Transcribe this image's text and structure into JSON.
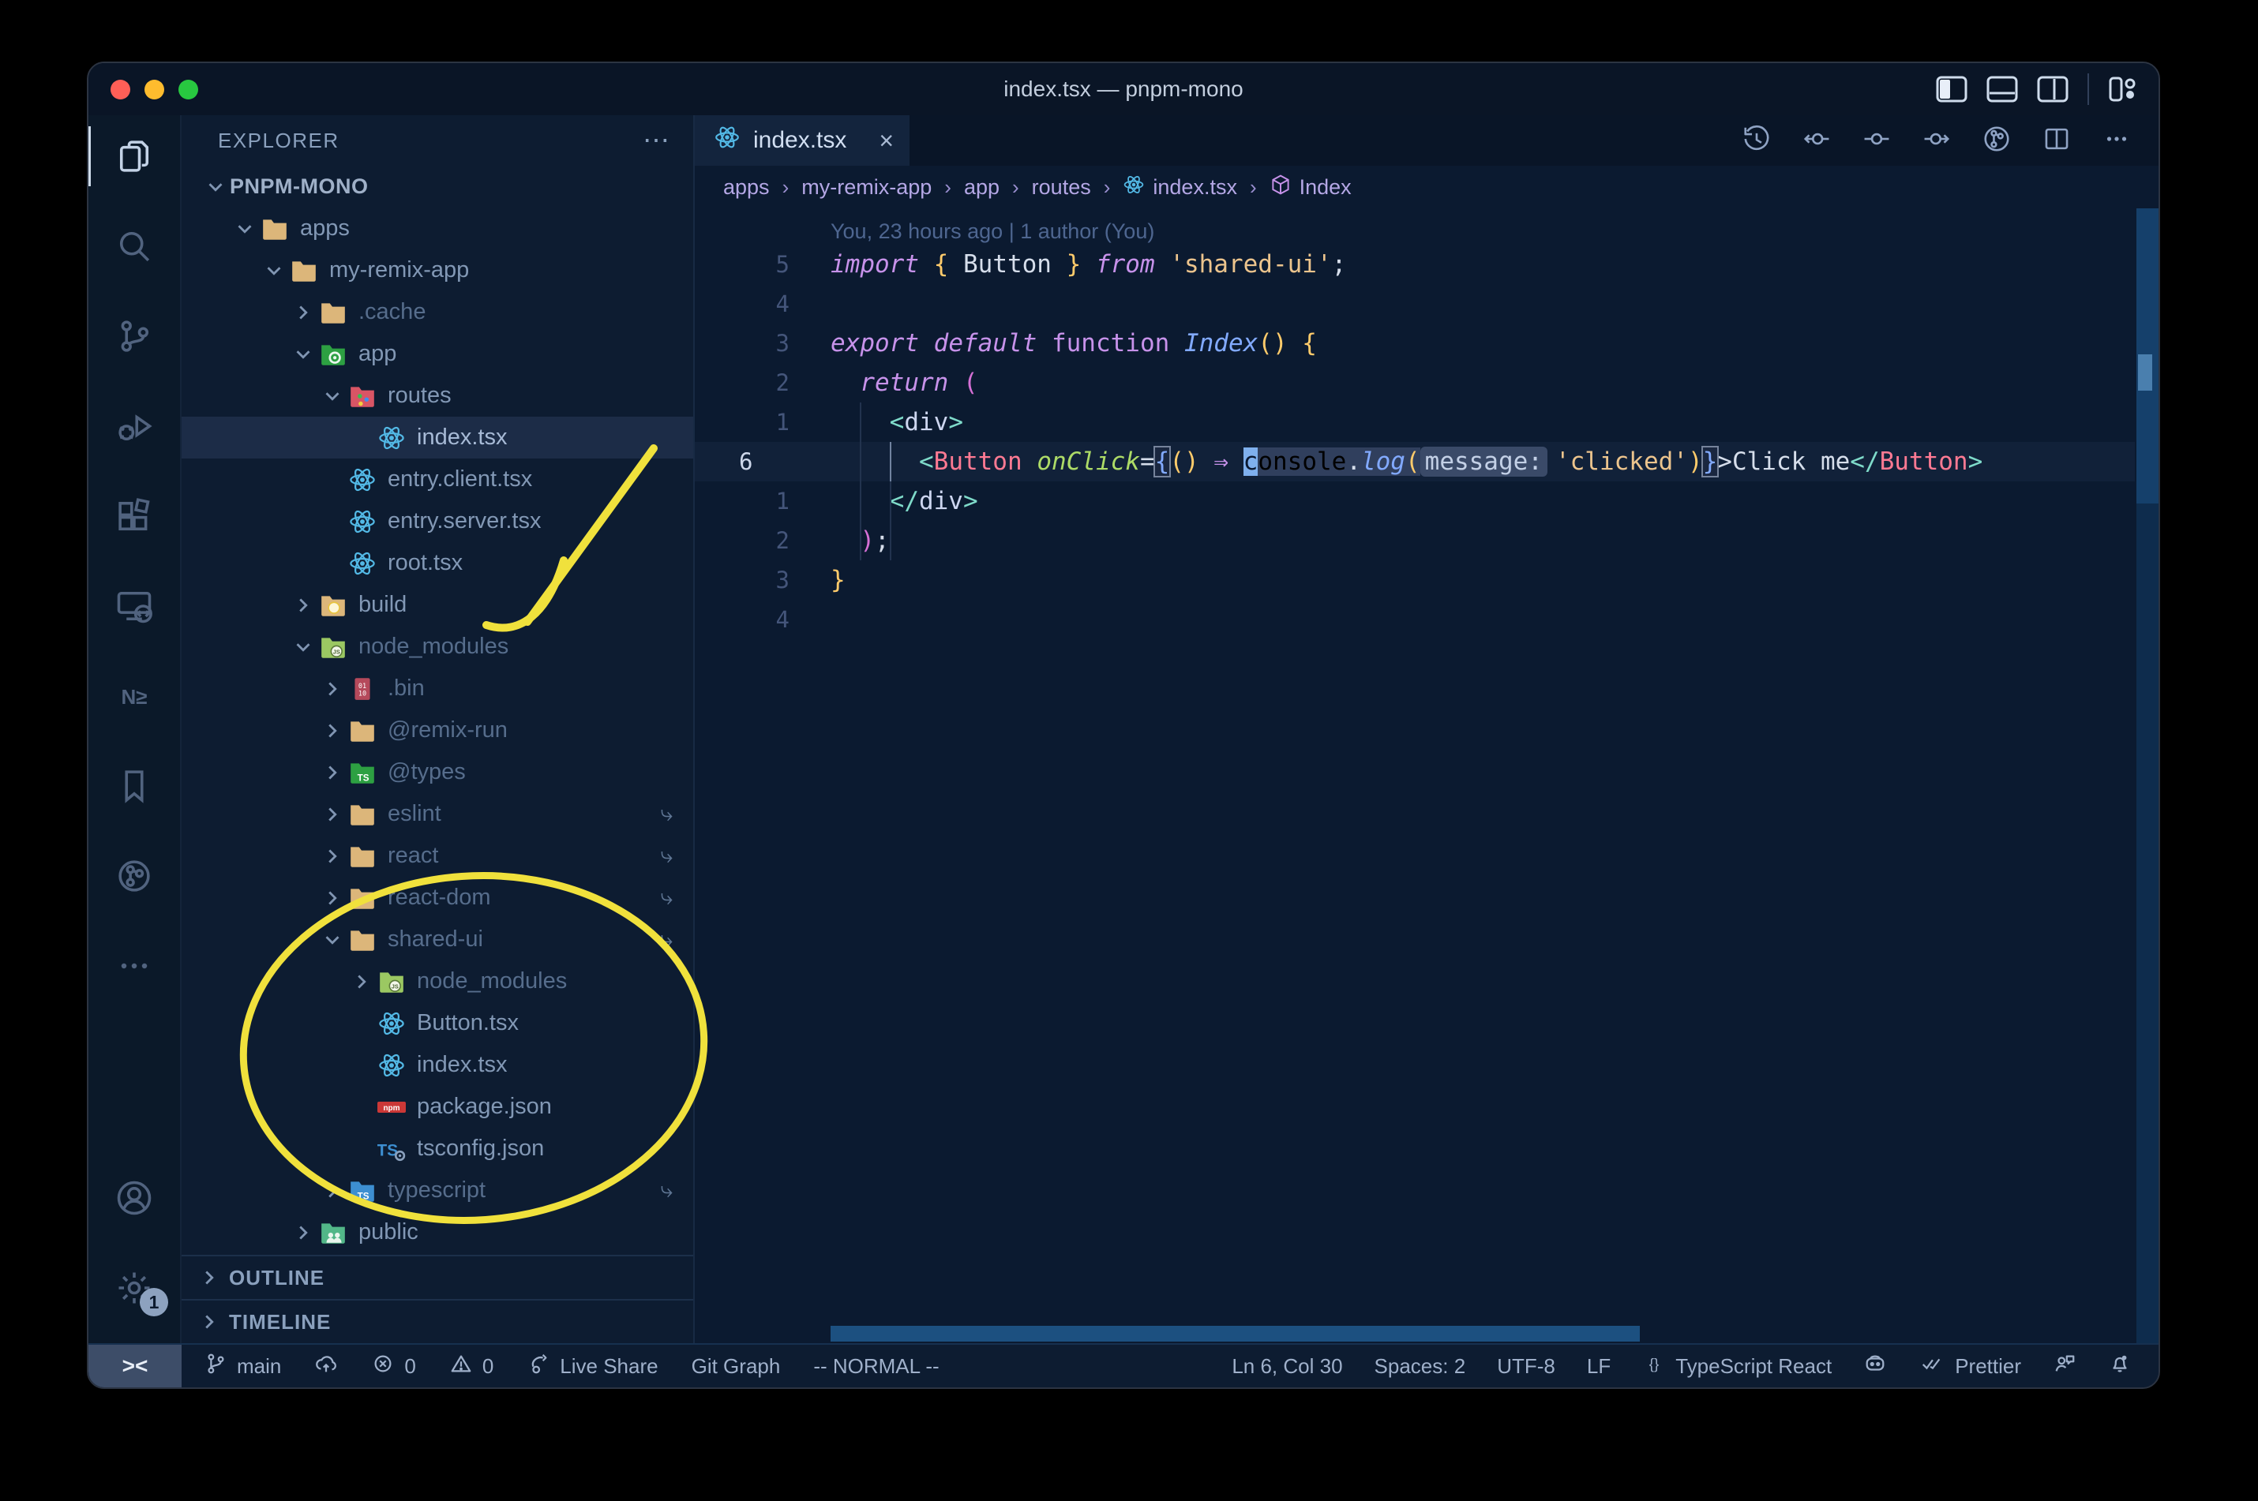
{
  "window": {
    "title": "index.tsx — pnpm-mono"
  },
  "colors": {
    "annotation_yellow": "#f0e13c",
    "react_blue": "#53b9e6",
    "folder_tan": "#dcb67a",
    "keyword_purple": "#c792ea",
    "string_peach": "#ecc48d",
    "tag_salmon": "#ff7a93",
    "attr_green": "#addb67",
    "fn_blue": "#82aaff",
    "brace_yellow": "#ffcb6b",
    "editor_bg": "#0b1a30",
    "selection_row": "#1c2c47",
    "traffic_red": "#ff5f57",
    "traffic_yellow": "#febc2e",
    "traffic_green": "#28c840"
  },
  "activity_bar": {
    "items": [
      {
        "name": "explorer",
        "active": true
      },
      {
        "name": "search",
        "active": false
      },
      {
        "name": "source-control",
        "active": false
      },
      {
        "name": "run-debug",
        "active": false
      },
      {
        "name": "extensions",
        "active": false
      },
      {
        "name": "remote-explorer",
        "active": false
      },
      {
        "name": "nx-console",
        "active": false
      },
      {
        "name": "bookmarks",
        "active": false
      },
      {
        "name": "gitlens",
        "active": false
      },
      {
        "name": "more",
        "active": false
      }
    ],
    "bottom_items": [
      {
        "name": "accounts"
      },
      {
        "name": "settings",
        "badge": "1"
      }
    ]
  },
  "sidebar": {
    "header": "EXPLORER",
    "header_more": "⋯",
    "root": "PNPM-MONO",
    "files": [
      {
        "label": "apps",
        "depth": 1,
        "chev": "down",
        "icon": "folder-tan"
      },
      {
        "label": "my-remix-app",
        "depth": 2,
        "chev": "down",
        "icon": "folder-tan"
      },
      {
        "label": ".cache",
        "depth": 3,
        "chev": "right",
        "icon": "folder-tan",
        "dim": true
      },
      {
        "label": "app",
        "depth": 3,
        "chev": "down",
        "icon": "folder-app"
      },
      {
        "label": "routes",
        "depth": 4,
        "chev": "down",
        "icon": "folder-routes"
      },
      {
        "label": "index.tsx",
        "depth": 5,
        "icon": "react",
        "selected": true
      },
      {
        "label": "entry.client.tsx",
        "depth": 4,
        "icon": "react"
      },
      {
        "label": "entry.server.tsx",
        "depth": 4,
        "icon": "react"
      },
      {
        "label": "root.tsx",
        "depth": 4,
        "icon": "react"
      },
      {
        "label": "build",
        "depth": 3,
        "chev": "right",
        "icon": "folder-build"
      },
      {
        "label": "node_modules",
        "depth": 3,
        "chev": "down",
        "icon": "folder-nm",
        "dim": true
      },
      {
        "label": ".bin",
        "depth": 4,
        "chev": "right",
        "icon": "bin",
        "dim": true
      },
      {
        "label": "@remix-run",
        "depth": 4,
        "chev": "right",
        "icon": "folder-tan",
        "dim": true
      },
      {
        "label": "@types",
        "depth": 4,
        "chev": "right",
        "icon": "folder-types",
        "dim": true
      },
      {
        "label": "eslint",
        "depth": 4,
        "chev": "right",
        "icon": "folder-tan",
        "dim": true,
        "symlink": true
      },
      {
        "label": "react",
        "depth": 4,
        "chev": "right",
        "icon": "folder-tan",
        "dim": true,
        "symlink": true
      },
      {
        "label": "react-dom",
        "depth": 4,
        "chev": "right",
        "icon": "folder-tan",
        "dim": true,
        "symlink": true
      },
      {
        "label": "shared-ui",
        "depth": 4,
        "chev": "down",
        "icon": "folder-tan",
        "dim": true,
        "symlink": true
      },
      {
        "label": "node_modules",
        "depth": 5,
        "chev": "right",
        "icon": "folder-nm",
        "dim": true
      },
      {
        "label": "Button.tsx",
        "depth": 5,
        "icon": "react"
      },
      {
        "label": "index.tsx",
        "depth": 5,
        "icon": "react"
      },
      {
        "label": "package.json",
        "depth": 5,
        "icon": "npm"
      },
      {
        "label": "tsconfig.json",
        "depth": 5,
        "icon": "ts-config"
      },
      {
        "label": "typescript",
        "depth": 4,
        "chev": "right",
        "icon": "folder-ts",
        "dim": true,
        "symlink": true
      },
      {
        "label": "public",
        "depth": 3,
        "chev": "right",
        "icon": "folder-public"
      }
    ],
    "sections": [
      "OUTLINE",
      "TIMELINE"
    ]
  },
  "tab": {
    "label": "index.tsx",
    "close": "×"
  },
  "editor_actions": [
    "history",
    "commit-back",
    "commit",
    "commit-forward",
    "gitlens-graph",
    "split-editor",
    "more-actions"
  ],
  "breadcrumbs": [
    {
      "label": "apps"
    },
    {
      "label": "my-remix-app"
    },
    {
      "label": "app"
    },
    {
      "label": "routes"
    },
    {
      "label": "index.tsx",
      "icon": "react"
    },
    {
      "label": "Index",
      "icon": "symbol-module"
    }
  ],
  "editor": {
    "blame": "You, 23 hours ago | 1 author (You)",
    "lines": [
      {
        "n": "5",
        "seg": [
          [
            "kw",
            "import"
          ],
          [
            "w",
            " "
          ],
          [
            "by",
            "{"
          ],
          [
            "w",
            " Button "
          ],
          [
            "by",
            "}"
          ],
          [
            "w",
            " "
          ],
          [
            "kw",
            "from"
          ],
          [
            "w",
            " "
          ],
          [
            "s",
            "'shared-ui'"
          ],
          [
            "w",
            ";"
          ]
        ]
      },
      {
        "n": "4",
        "seg": []
      },
      {
        "n": "3",
        "seg": [
          [
            "kw",
            "export"
          ],
          [
            "w",
            " "
          ],
          [
            "kw",
            "default"
          ],
          [
            "w",
            " "
          ],
          [
            "kwu",
            "function"
          ],
          [
            "w",
            " "
          ],
          [
            "fb",
            "Index"
          ],
          [
            "by",
            "()"
          ],
          [
            "w",
            " "
          ],
          [
            "by",
            "{"
          ]
        ]
      },
      {
        "n": "2",
        "seg": [
          [
            "w",
            "  "
          ],
          [
            "kw",
            "return"
          ],
          [
            "w",
            " "
          ],
          [
            "pp",
            "("
          ]
        ]
      },
      {
        "n": "1",
        "seg": [
          [
            "w",
            "    "
          ],
          [
            "tagA",
            "<"
          ],
          [
            "el",
            "div"
          ],
          [
            "tagA",
            ">"
          ]
        ]
      },
      {
        "n": "6",
        "current": true,
        "seg": [
          [
            "w",
            "      "
          ],
          [
            "tagA",
            "<"
          ],
          [
            "tag",
            "Button"
          ],
          [
            "w",
            " "
          ],
          [
            "attr",
            "onClick"
          ],
          [
            "w",
            "="
          ],
          [
            "bx",
            "{"
          ],
          [
            "by",
            "()"
          ],
          [
            "w",
            " "
          ],
          [
            "ar",
            "⇒"
          ],
          [
            "w",
            " "
          ],
          [
            "cur",
            "c"
          ],
          [
            "hl",
            "onsole"
          ],
          [
            "hlw",
            "."
          ],
          [
            "hlf",
            "log"
          ],
          [
            "hly",
            "("
          ],
          [
            "inlay",
            "message:"
          ],
          [
            "s",
            "'clicked'"
          ],
          [
            "by",
            ")"
          ],
          [
            "bx",
            "}"
          ],
          [
            "w",
            ">Click me"
          ],
          [
            "tagA",
            "</"
          ],
          [
            "tag",
            "Button"
          ],
          [
            "tagA",
            ">"
          ]
        ]
      },
      {
        "n": "1",
        "seg": [
          [
            "w",
            "    "
          ],
          [
            "tagA",
            "</"
          ],
          [
            "el",
            "div"
          ],
          [
            "tagA",
            ">"
          ]
        ]
      },
      {
        "n": "2",
        "seg": [
          [
            "w",
            "  "
          ],
          [
            "pp",
            ")"
          ],
          [
            "w",
            ";"
          ]
        ]
      },
      {
        "n": "3",
        "seg": [
          [
            "by",
            "}"
          ]
        ]
      },
      {
        "n": "4",
        "seg": []
      }
    ]
  },
  "status_bar": {
    "remote_icon": "><",
    "left": [
      {
        "name": "git-branch",
        "icon": "branch",
        "label": "main"
      },
      {
        "name": "publish",
        "icon": "cloud-upload",
        "label": ""
      },
      {
        "name": "errors",
        "icon": "error",
        "label": "0"
      },
      {
        "name": "warnings",
        "icon": "warning",
        "label": "0"
      },
      {
        "name": "live-share",
        "icon": "live-share",
        "label": "Live Share"
      },
      {
        "name": "git-graph",
        "icon": "",
        "label": "Git Graph"
      },
      {
        "name": "vim-mode",
        "icon": "",
        "label": "-- NORMAL --"
      }
    ],
    "right": [
      {
        "name": "cursor-position",
        "icon": "",
        "label": "Ln 6, Col 30"
      },
      {
        "name": "indentation",
        "icon": "",
        "label": "Spaces: 2"
      },
      {
        "name": "encoding",
        "icon": "",
        "label": "UTF-8"
      },
      {
        "name": "eol",
        "icon": "",
        "label": "LF"
      },
      {
        "name": "language-mode",
        "icon": "braces",
        "label": "TypeScript React"
      },
      {
        "name": "copilot",
        "icon": "copilot",
        "label": ""
      },
      {
        "name": "prettier",
        "icon": "double-check",
        "label": "Prettier"
      },
      {
        "name": "feedback",
        "icon": "feedback",
        "label": ""
      },
      {
        "name": "notifications",
        "icon": "bell",
        "label": ""
      }
    ]
  }
}
